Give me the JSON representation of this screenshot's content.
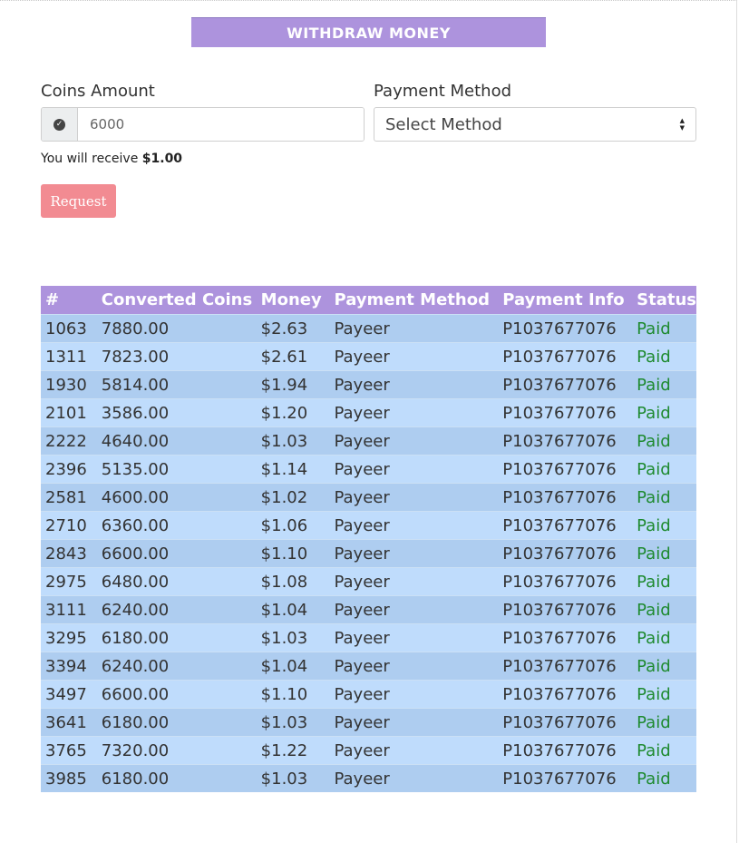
{
  "page": {
    "title": "WITHDRAW MONEY"
  },
  "form": {
    "coins_label": "Coins Amount",
    "coins_value": "6000",
    "coins_addon_icon": "check-circle-icon",
    "method_label": "Payment Method",
    "method_selected": "Select Method",
    "receive_prefix": "You will receive",
    "receive_amount": "$1.00",
    "request_label": "Request"
  },
  "colors": {
    "header_purple": "#ad93dd",
    "request_button": "#f28b92",
    "row_odd": "#aecdf0",
    "row_even": "#bfdcfc",
    "status_paid": "#1e8a2f"
  },
  "table": {
    "headers": [
      "#",
      "Converted Coins",
      "Money",
      "Payment Method",
      "Payment Info",
      "Status"
    ],
    "rows": [
      [
        "1063",
        "7880.00",
        "$2.63",
        "Payeer",
        "P1037677076",
        "Paid"
      ],
      [
        "1311",
        "7823.00",
        "$2.61",
        "Payeer",
        "P1037677076",
        "Paid"
      ],
      [
        "1930",
        "5814.00",
        "$1.94",
        "Payeer",
        "P1037677076",
        "Paid"
      ],
      [
        "2101",
        "3586.00",
        "$1.20",
        "Payeer",
        "P1037677076",
        "Paid"
      ],
      [
        "2222",
        "4640.00",
        "$1.03",
        "Payeer",
        "P1037677076",
        "Paid"
      ],
      [
        "2396",
        "5135.00",
        "$1.14",
        "Payeer",
        "P1037677076",
        "Paid"
      ],
      [
        "2581",
        "4600.00",
        "$1.02",
        "Payeer",
        "P1037677076",
        "Paid"
      ],
      [
        "2710",
        "6360.00",
        "$1.06",
        "Payeer",
        "P1037677076",
        "Paid"
      ],
      [
        "2843",
        "6600.00",
        "$1.10",
        "Payeer",
        "P1037677076",
        "Paid"
      ],
      [
        "2975",
        "6480.00",
        "$1.08",
        "Payeer",
        "P1037677076",
        "Paid"
      ],
      [
        "3111",
        "6240.00",
        "$1.04",
        "Payeer",
        "P1037677076",
        "Paid"
      ],
      [
        "3295",
        "6180.00",
        "$1.03",
        "Payeer",
        "P1037677076",
        "Paid"
      ],
      [
        "3394",
        "6240.00",
        "$1.04",
        "Payeer",
        "P1037677076",
        "Paid"
      ],
      [
        "3497",
        "6600.00",
        "$1.10",
        "Payeer",
        "P1037677076",
        "Paid"
      ],
      [
        "3641",
        "6180.00",
        "$1.03",
        "Payeer",
        "P1037677076",
        "Paid"
      ],
      [
        "3765",
        "7320.00",
        "$1.22",
        "Payeer",
        "P1037677076",
        "Paid"
      ],
      [
        "3985",
        "6180.00",
        "$1.03",
        "Payeer",
        "P1037677076",
        "Paid"
      ]
    ]
  }
}
